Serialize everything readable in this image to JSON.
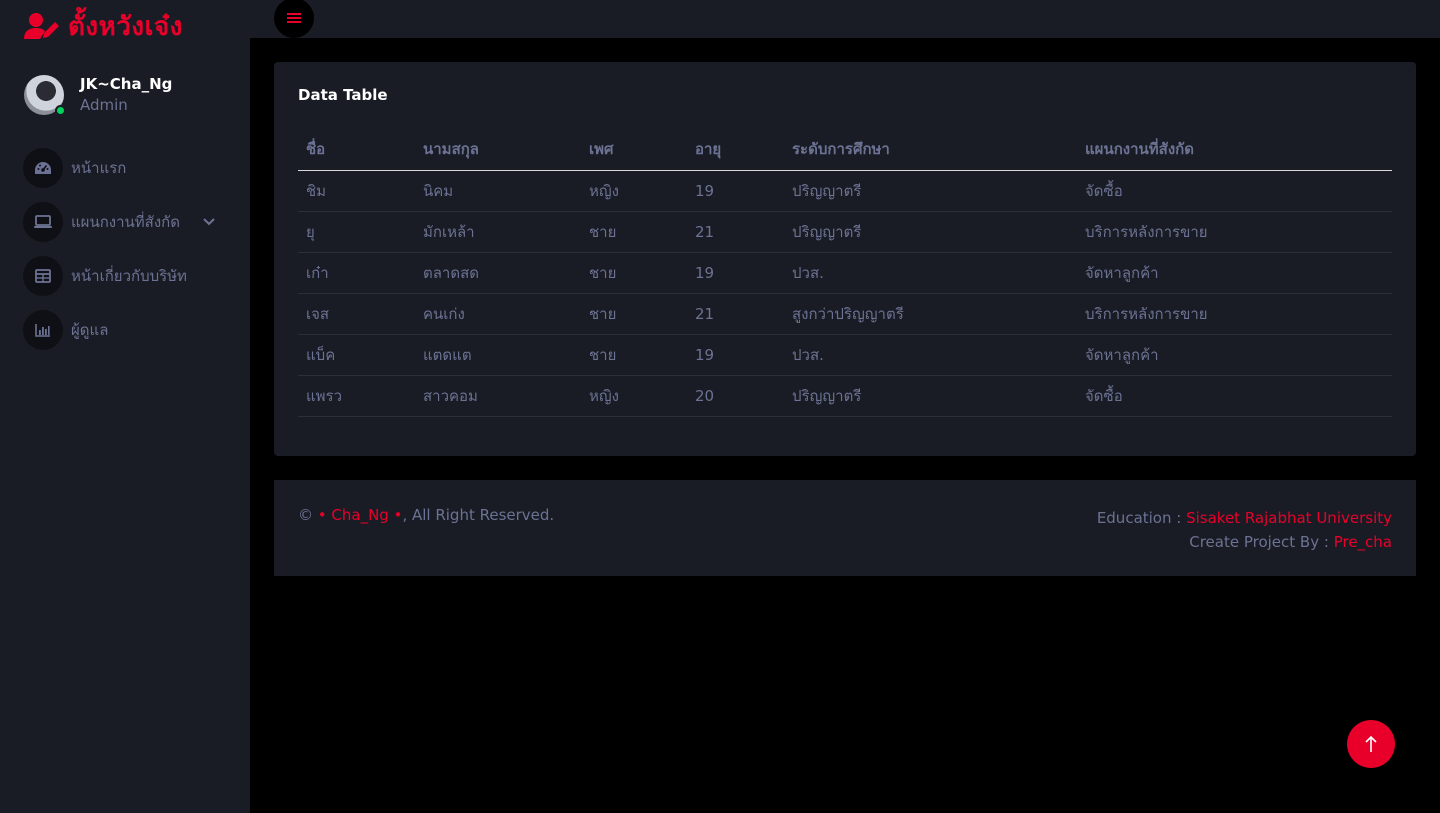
{
  "brand": {
    "title": "ตั้งหวังเจ๋ง",
    "icon": "user-edit-icon",
    "color": "#e8002a"
  },
  "profile": {
    "name": "JK~Cha_Ng",
    "role": "Admin",
    "status_color": "#00d25b"
  },
  "sidebar": {
    "items": [
      {
        "label": "หน้าแรก",
        "icon": "speedometer-icon"
      },
      {
        "label": "แผนกงานที่สังกัด",
        "icon": "laptop-icon",
        "has_submenu": true
      },
      {
        "label": "หน้าเกี่ยวกับบริษัท",
        "icon": "table-icon"
      },
      {
        "label": "ผู้ดูแล",
        "icon": "chart-bar-icon"
      }
    ]
  },
  "topbar": {
    "menu_icon": "hamburger-menu-icon"
  },
  "card": {
    "title": "Data Table",
    "columns": [
      "ชื่อ",
      "นามสกุล",
      "เพศ",
      "อายุ",
      "ระดับการศึกษา",
      "แผนกงานที่สังกัด"
    ],
    "rows": [
      [
        "ชิม",
        "นิคม",
        "หญิง",
        "19",
        "ปริญญาตรี",
        "จัดซื้อ"
      ],
      [
        "ยุ",
        "มักเหล้า",
        "ชาย",
        "21",
        "ปริญญาตรี",
        "บริการหลังการขาย"
      ],
      [
        "เก๋า",
        "ตลาดสด",
        "ชาย",
        "19",
        "ปวส.",
        "จัดหาลูกค้า"
      ],
      [
        "เจส",
        "คนเก่ง",
        "ชาย",
        "21",
        "สูงกว่าปริญญาตรี",
        "บริการหลังการขาย"
      ],
      [
        "แบ็ค",
        "แตดแต",
        "ชาย",
        "19",
        "ปวส.",
        "จัดหาลูกค้า"
      ],
      [
        "แพรว",
        "สาวคอม",
        "หญิง",
        "20",
        "ปริญญาตรี",
        "จัดซื้อ"
      ]
    ]
  },
  "footer": {
    "copyright_symbol": "©",
    "author": "• Cha_Ng •",
    "rights": ", All Right Reserved.",
    "education_label": "Education :",
    "education_value": "Sisaket Rajabhat University",
    "project_label": "Create Project By :",
    "project_value": "Pre_cha"
  },
  "back_to_top": {
    "icon": "arrow-up-icon"
  }
}
